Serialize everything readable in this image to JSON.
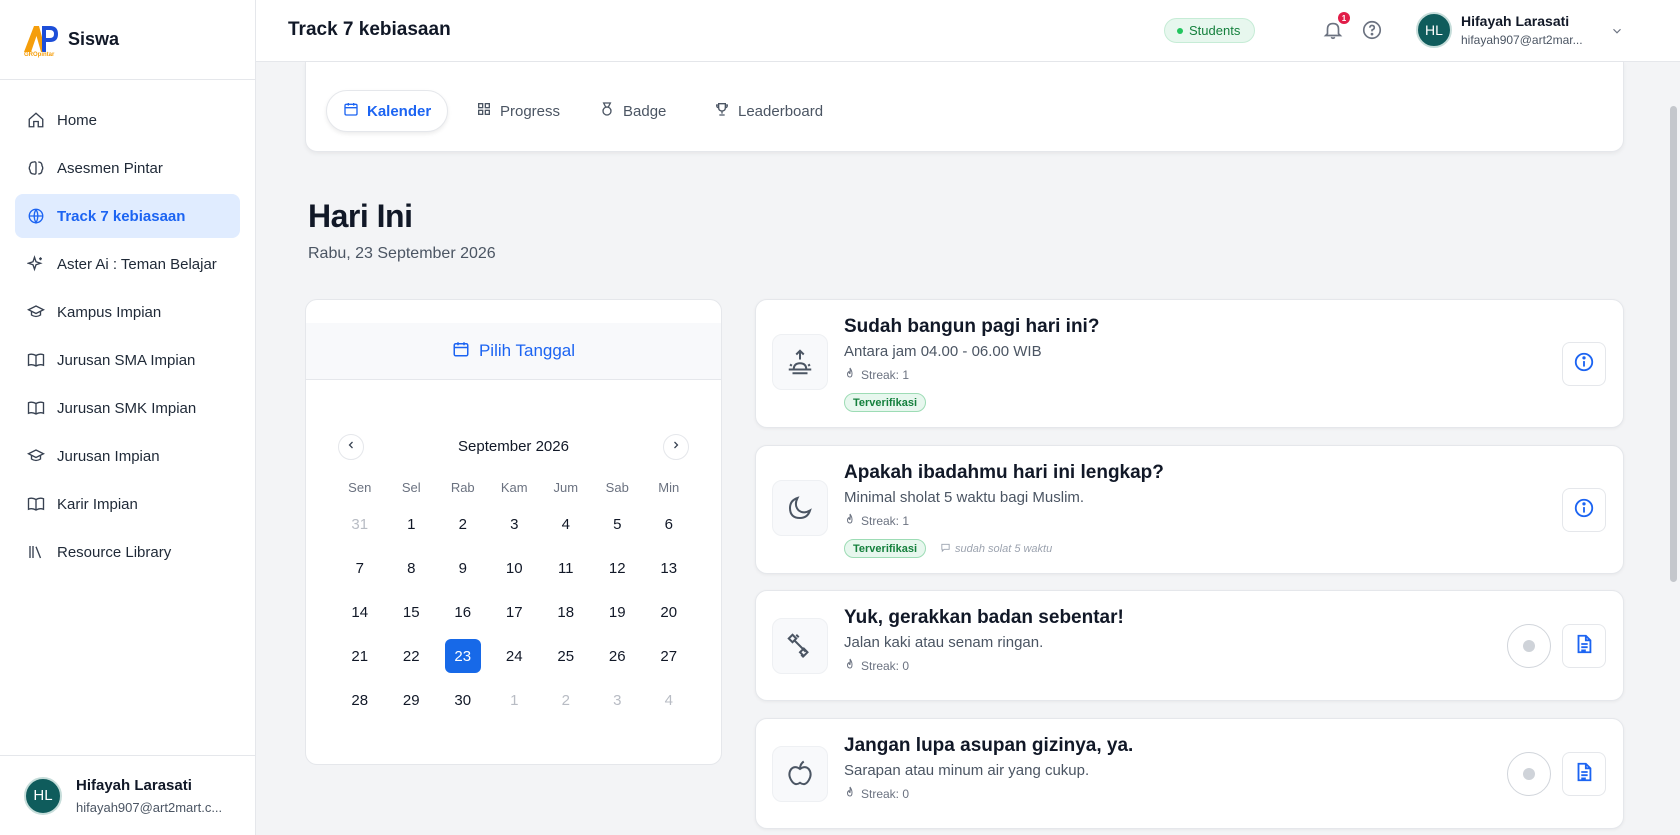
{
  "brand": {
    "name": "Siswa",
    "logo_caption": "GROpintar"
  },
  "sidebar": {
    "items": [
      {
        "label": "Home",
        "icon": "home-icon"
      },
      {
        "label": "Asesmen Pintar",
        "icon": "brain-icon"
      },
      {
        "label": "Track 7 kebiasaan",
        "icon": "globe-icon",
        "active": true
      },
      {
        "label": "Aster Ai : Teman Belajar",
        "icon": "sparkles-icon"
      },
      {
        "label": "Kampus Impian",
        "icon": "graduation-cap-icon"
      },
      {
        "label": "Jurusan SMA Impian",
        "icon": "book-icon"
      },
      {
        "label": "Jurusan SMK Impian",
        "icon": "book-icon"
      },
      {
        "label": "Jurusan Impian",
        "icon": "graduation-cap-icon"
      },
      {
        "label": "Karir Impian",
        "icon": "book-icon"
      },
      {
        "label": "Resource Library",
        "icon": "library-icon"
      }
    ],
    "user": {
      "initials": "HL",
      "name": "Hifayah Larasati",
      "email": "hifayah907@art2mart.c..."
    }
  },
  "header": {
    "title": "Track 7 kebiasaan",
    "role_badge": "Students",
    "notification_count": "1",
    "user": {
      "initials": "HL",
      "name": "Hifayah Larasati",
      "email": "hifayah907@art2mar..."
    }
  },
  "tabs": [
    {
      "label": "Kalender",
      "icon": "calendar-icon",
      "active": true
    },
    {
      "label": "Progress",
      "icon": "grid-icon"
    },
    {
      "label": "Badge",
      "icon": "medal-icon"
    },
    {
      "label": "Leaderboard",
      "icon": "trophy-icon"
    }
  ],
  "today": {
    "title": "Hari Ini",
    "date": "Rabu, 23 September 2026"
  },
  "calendar": {
    "header_label": "Pilih Tanggal",
    "month_label": "September 2026",
    "weekdays": [
      "Sen",
      "Sel",
      "Rab",
      "Kam",
      "Jum",
      "Sab",
      "Min"
    ],
    "days": [
      {
        "d": "31",
        "muted": true
      },
      {
        "d": "1"
      },
      {
        "d": "2"
      },
      {
        "d": "3"
      },
      {
        "d": "4"
      },
      {
        "d": "5"
      },
      {
        "d": "6"
      },
      {
        "d": "7"
      },
      {
        "d": "8"
      },
      {
        "d": "9"
      },
      {
        "d": "10"
      },
      {
        "d": "11"
      },
      {
        "d": "12"
      },
      {
        "d": "13"
      },
      {
        "d": "14"
      },
      {
        "d": "15"
      },
      {
        "d": "16"
      },
      {
        "d": "17"
      },
      {
        "d": "18"
      },
      {
        "d": "19"
      },
      {
        "d": "20"
      },
      {
        "d": "21"
      },
      {
        "d": "22"
      },
      {
        "d": "23",
        "selected": true
      },
      {
        "d": "24"
      },
      {
        "d": "25"
      },
      {
        "d": "26"
      },
      {
        "d": "27"
      },
      {
        "d": "28"
      },
      {
        "d": "29"
      },
      {
        "d": "30"
      },
      {
        "d": "1",
        "muted": true
      },
      {
        "d": "2",
        "muted": true
      },
      {
        "d": "3",
        "muted": true
      },
      {
        "d": "4",
        "muted": true
      }
    ]
  },
  "habits": [
    {
      "title": "Sudah bangun pagi hari ini?",
      "desc": "Antara jam 04.00 - 06.00 WIB",
      "streak": "Streak: 1",
      "badge": "Terverifikasi",
      "note": "",
      "icon": "sunrise-icon",
      "action": "info"
    },
    {
      "title": "Apakah ibadahmu hari ini lengkap?",
      "desc": "Minimal sholat 5 waktu bagi Muslim.",
      "streak": "Streak: 1",
      "badge": "Terverifikasi",
      "note": "sudah solat 5 waktu",
      "icon": "moon-icon",
      "action": "info"
    },
    {
      "title": "Yuk, gerakkan badan sebentar!",
      "desc": "Jalan kaki atau senam ringan.",
      "streak": "Streak: 0",
      "badge": "",
      "note": "",
      "icon": "dumbbell-icon",
      "action": "form"
    },
    {
      "title": "Jangan lupa asupan gizinya, ya.",
      "desc": "Sarapan atau minum air yang cukup.",
      "streak": "Streak: 0",
      "badge": "",
      "note": "",
      "icon": "apple-icon",
      "action": "form"
    }
  ],
  "colors": {
    "accent": "#1c64f2",
    "active_bg": "#e0ecff",
    "success": "#15803d",
    "avatar": "#0f5c5c"
  }
}
